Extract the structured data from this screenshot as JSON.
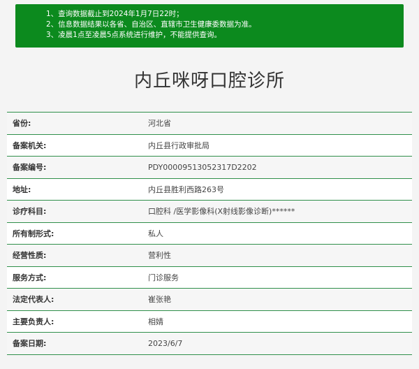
{
  "notice": {
    "lines": [
      "1、查询数据截止到2024年1月7日22时；",
      "2、信息数据结果以各省、自治区、直辖市卫生健康委数据为准。",
      "3、凌晨1点至凌晨5点系统进行维护，不能提供查询。"
    ]
  },
  "page_title": "内丘咪呀口腔诊所",
  "rows": [
    {
      "label": "省份:",
      "value": "河北省"
    },
    {
      "label": "备案机关:",
      "value": "内丘县行政审批局"
    },
    {
      "label": "备案编号:",
      "value": "PDY00009513052317D2202"
    },
    {
      "label": "地址:",
      "value": "内丘县胜利西路263号"
    },
    {
      "label": "诊疗科目:",
      "value": "口腔科 /医学影像科(X射线影像诊断)******"
    },
    {
      "label": "所有制形式:",
      "value": "私人"
    },
    {
      "label": "经营性质:",
      "value": "营利性"
    },
    {
      "label": "服务方式:",
      "value": "门诊服务"
    },
    {
      "label": "法定代表人:",
      "value": "崔张艳"
    },
    {
      "label": "主要负责人:",
      "value": "相婧"
    },
    {
      "label": "备案日期:",
      "value": "2023/6/7"
    }
  ]
}
